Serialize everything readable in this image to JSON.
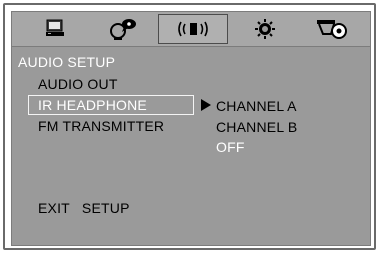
{
  "menu": {
    "title": "AUDIO SETUP",
    "items": [
      {
        "label": "AUDIO OUT"
      },
      {
        "label": "IR HEADPHONE"
      },
      {
        "label": "FM TRANSMITTER"
      }
    ],
    "options": [
      {
        "label": "CHANNEL A"
      },
      {
        "label": "CHANNEL B"
      },
      {
        "label": "OFF"
      }
    ],
    "exit_label": "EXIT   SETUP"
  },
  "toolbar": {
    "tabs": [
      {
        "icon": "monitor-icon"
      },
      {
        "icon": "language-icon"
      },
      {
        "icon": "audio-icon",
        "active": true
      },
      {
        "icon": "video-icon"
      },
      {
        "icon": "speaker-icon"
      }
    ]
  },
  "colors": {
    "panel": "#9a9a9a",
    "toolbar": "#a7a7a7",
    "highlight_text": "#ffffff"
  }
}
